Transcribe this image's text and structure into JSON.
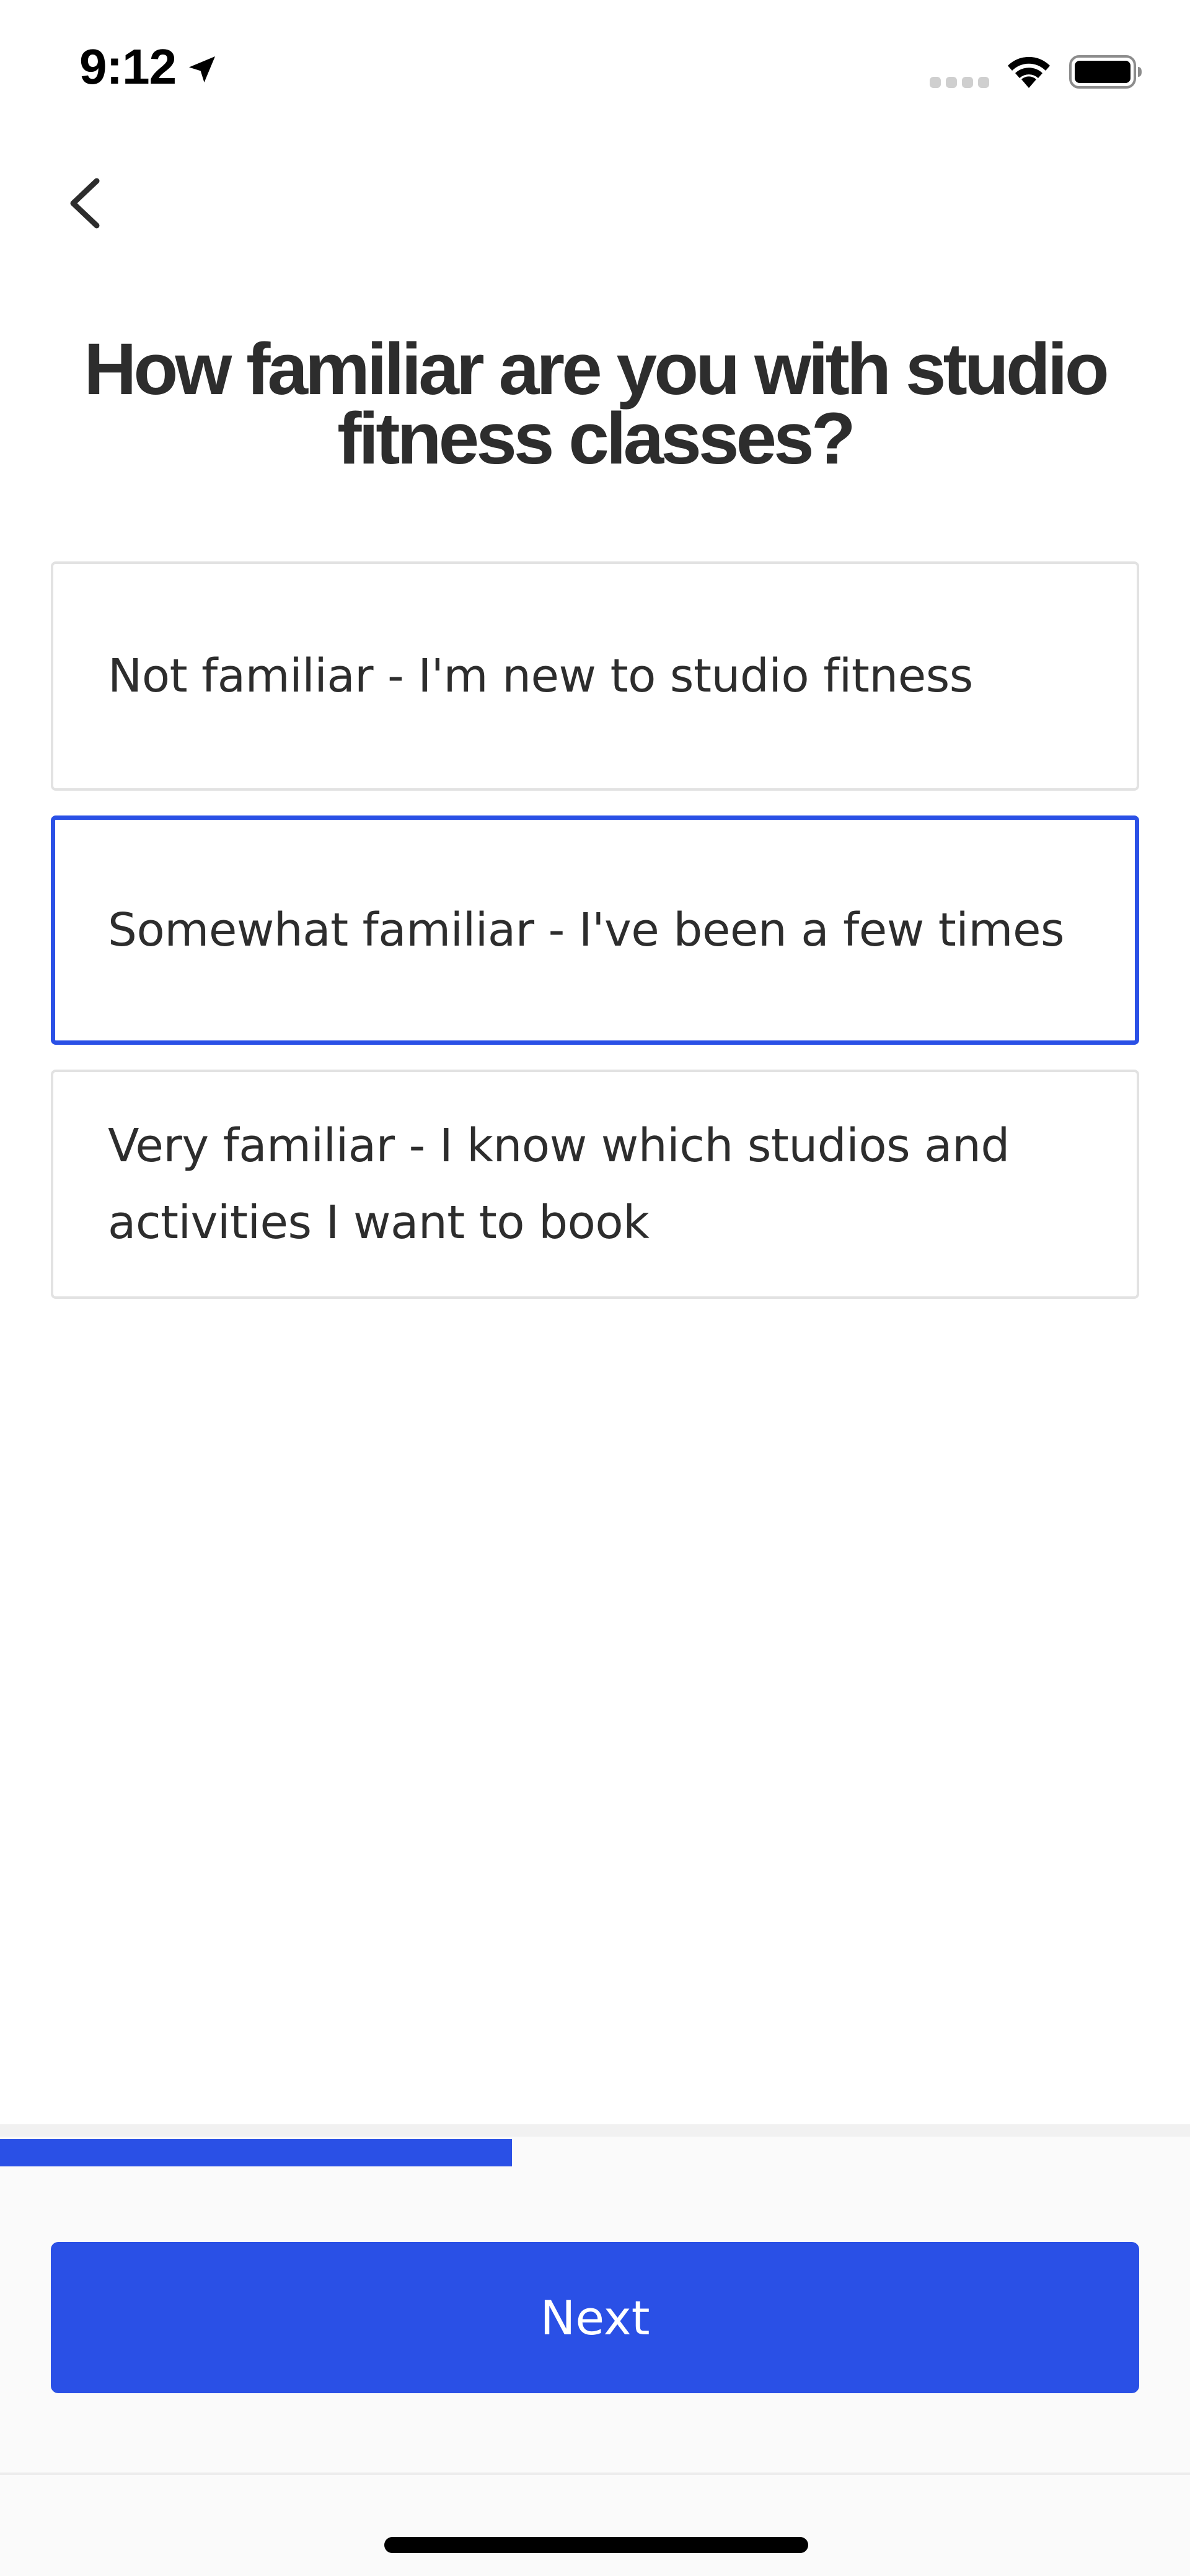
{
  "status_bar": {
    "time": "9:12",
    "icons": [
      "location-arrow-icon",
      "signal-dots-icon",
      "wifi-icon",
      "battery-icon"
    ]
  },
  "navigation": {
    "back_icon": "chevron-left-icon"
  },
  "question": {
    "title": "How familiar are you with studio fitness classes?"
  },
  "options": [
    {
      "label": "Not familiar - I'm new to studio fitness",
      "selected": false
    },
    {
      "label": "Somewhat familiar - I've been a few times",
      "selected": true
    },
    {
      "label": "Very familiar - I know which studios and activities I want to book",
      "selected": false
    }
  ],
  "progress": {
    "fraction": 0.43
  },
  "footer": {
    "next_label": "Next"
  },
  "colors": {
    "accent": "#2a50e6",
    "text": "#2d2d2d",
    "option_border": "#e2e2e2",
    "background": "#ffffff"
  }
}
